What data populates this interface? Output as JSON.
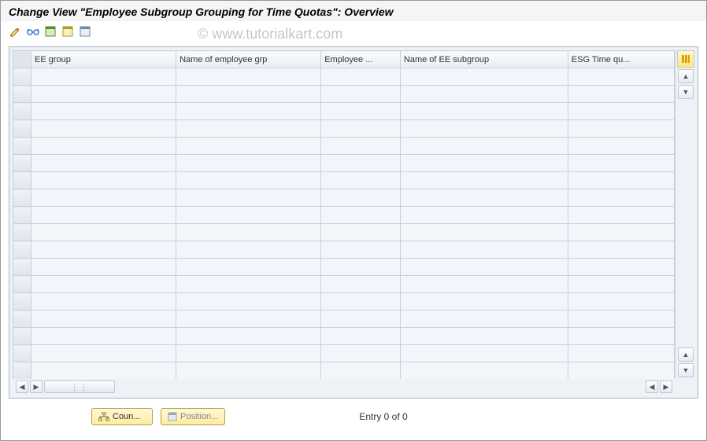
{
  "title": "Change View \"Employee Subgroup Grouping for Time Quotas\": Overview",
  "watermark": "© www.tutorialkart.com",
  "toolbar": {
    "icons": [
      "edit-doc-icon",
      "glasses-icon",
      "select-all-icon",
      "save-icon",
      "deselect-icon"
    ]
  },
  "table": {
    "columns": [
      {
        "key": "ee_group",
        "label": "EE group"
      },
      {
        "key": "name_grp",
        "label": "Name of employee grp"
      },
      {
        "key": "employee",
        "label": "Employee ..."
      },
      {
        "key": "name_sub",
        "label": "Name of EE subgroup"
      },
      {
        "key": "esg_time",
        "label": "ESG Time qu..."
      }
    ],
    "rows": [
      {},
      {},
      {},
      {},
      {},
      {},
      {},
      {},
      {},
      {},
      {},
      {},
      {},
      {},
      {},
      {},
      {},
      {}
    ]
  },
  "footer": {
    "countrysub_label": "Coun...",
    "position_label": "Position...",
    "entry_text": "Entry 0 of 0"
  }
}
